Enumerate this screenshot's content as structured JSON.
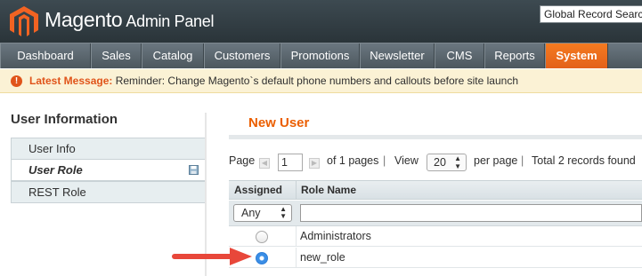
{
  "header": {
    "brand_name": "Magento",
    "brand_suffix": "Admin Panel",
    "search_value": "Global Record Search"
  },
  "nav": {
    "items": [
      {
        "label": "Dashboard"
      },
      {
        "label": "Sales"
      },
      {
        "label": "Catalog"
      },
      {
        "label": "Customers"
      },
      {
        "label": "Promotions"
      },
      {
        "label": "Newsletter"
      },
      {
        "label": "CMS"
      },
      {
        "label": "Reports"
      },
      {
        "label": "System"
      }
    ],
    "active": "System"
  },
  "message": {
    "label": "Latest Message:",
    "text": "Reminder: Change Magento`s default phone numbers and callouts before site launch"
  },
  "sidebar": {
    "title": "User Information",
    "tabs": [
      {
        "label": "User Info"
      },
      {
        "label": "User Role"
      },
      {
        "label": "REST Role"
      }
    ],
    "active_tab": "User Role"
  },
  "main": {
    "title": "New User",
    "pager": {
      "page_label": "Page",
      "page_value": "1",
      "of_pages": "of 1 pages",
      "view_label": "View",
      "per_page_value": "20",
      "per_page_label": "per page",
      "records": "Total 2 records found"
    },
    "grid": {
      "columns": [
        "Assigned",
        "Role Name"
      ],
      "assigned_filter": "Any",
      "rows": [
        {
          "name": "Administrators",
          "checked": false
        },
        {
          "name": "new_role",
          "checked": true
        }
      ]
    }
  },
  "colors": {
    "accent": "#eb5e00",
    "arrow": "#e8473a"
  }
}
